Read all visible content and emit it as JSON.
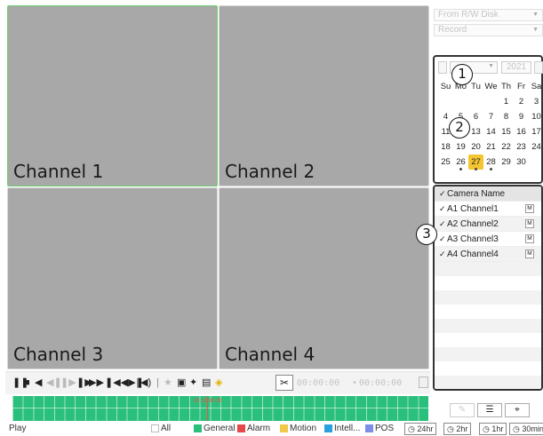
{
  "channels": [
    {
      "label": "Channel 1",
      "selected": true
    },
    {
      "label": "Channel 2",
      "selected": false
    },
    {
      "label": "Channel 3",
      "selected": false
    },
    {
      "label": "Channel 4",
      "selected": false
    }
  ],
  "toolbar": {
    "icons": [
      "pause-icon",
      "stop-icon",
      "reverse-play-icon",
      "slow-backward-icon",
      "slow-forward-icon",
      "fast-forward-icon",
      "skip-icon",
      "volume-icon",
      "person-icon",
      "snapshot-icon",
      "pin-icon",
      "frame-icon",
      "bulb-icon"
    ],
    "clip_start": "00:00:00",
    "clip_end": "00:00:00"
  },
  "timeline": {
    "current_time_label": "00:12:00:00",
    "color": "#2bbf7c"
  },
  "status": {
    "play_label": "Play"
  },
  "legend": [
    {
      "label": "All",
      "color": "#ffffff",
      "checked": false
    },
    {
      "label": "General",
      "color": "#2bbf7c",
      "checked": true
    },
    {
      "label": "Alarm",
      "color": "#e5474b",
      "checked": true
    },
    {
      "label": "Motion",
      "color": "#f0c84a",
      "checked": true
    },
    {
      "label": "Intell...",
      "color": "#2aa0e0",
      "checked": true
    },
    {
      "label": "POS",
      "color": "#7b8ee8",
      "checked": true
    }
  ],
  "zoom_options": [
    "24hr",
    "2hr",
    "1hr",
    "30min"
  ],
  "source": {
    "select_value": "From R/W Disk",
    "mode_value": "Record"
  },
  "calendar": {
    "year": "2021",
    "weekdays": [
      "Su",
      "Mo",
      "Tu",
      "We",
      "Th",
      "Fr",
      "Sa"
    ],
    "first_weekday": 4,
    "days_in_month": 30,
    "selected_day": 27,
    "record_days": [
      26,
      27,
      28
    ]
  },
  "cameras": {
    "header": "Camera Name",
    "items": [
      {
        "label": "A1 Channel1",
        "badge": "M"
      },
      {
        "label": "A2 Channel2",
        "badge": "M"
      },
      {
        "label": "A3 Channel3",
        "badge": "M"
      },
      {
        "label": "A4 Channel4",
        "badge": "M"
      }
    ]
  },
  "markers": [
    "1",
    "2",
    "3"
  ]
}
